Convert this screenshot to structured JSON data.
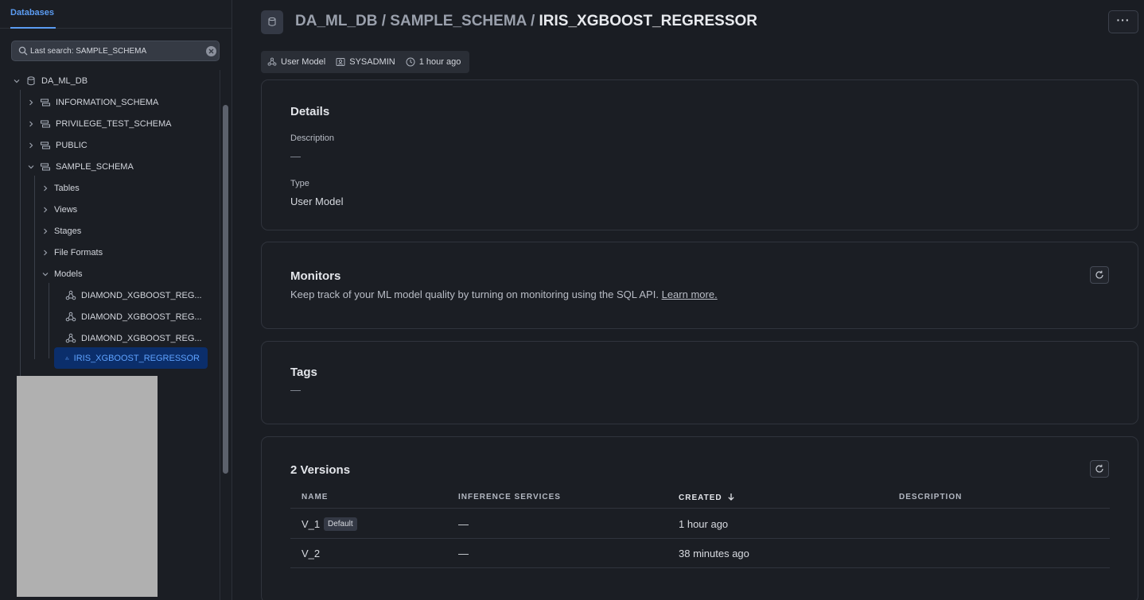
{
  "sidebar": {
    "tab_label": "Databases",
    "search": {
      "value": "",
      "placeholder": "Last search: SAMPLE_SCHEMA"
    },
    "tree": {
      "database": "DA_ML_DB",
      "schemas": [
        "INFORMATION_SCHEMA",
        "PRIVILEGE_TEST_SCHEMA",
        "PUBLIC",
        "SAMPLE_SCHEMA"
      ],
      "object_types": [
        "Tables",
        "Views",
        "Stages",
        "File Formats",
        "Models"
      ],
      "models": [
        "DIAMOND_XGBOOST_REG...",
        "DIAMOND_XGBOOST_REG...",
        "DIAMOND_XGBOOST_REG...",
        "IRIS_XGBOOST_REGRESSOR"
      ]
    }
  },
  "header": {
    "breadcrumb_db": "DA_ML_DB",
    "breadcrumb_sep1": " / ",
    "breadcrumb_schema": "SAMPLE_SCHEMA",
    "breadcrumb_sep2": " / ",
    "breadcrumb_model": "IRIS_XGBOOST_REGRESSOR",
    "more_label": "···",
    "meta": {
      "type": "User Model",
      "owner": "SYSADMIN",
      "time": "1 hour ago"
    }
  },
  "details": {
    "title": "Details",
    "description_label": "Description",
    "description_value": "—",
    "type_label": "Type",
    "type_value": "User Model"
  },
  "monitors": {
    "title": "Monitors",
    "text": "Keep track of your ML model quality by turning on monitoring using the SQL API.",
    "link": "Learn more."
  },
  "tags": {
    "title": "Tags",
    "value": "—"
  },
  "versions": {
    "title": "2 Versions",
    "columns": [
      "NAME",
      "INFERENCE SERVICES",
      "CREATED",
      "DESCRIPTION"
    ],
    "rows": [
      {
        "name": "V_1",
        "badge": "Default",
        "inference": "—",
        "created": "1 hour ago",
        "description": ""
      },
      {
        "name": "V_2",
        "badge": "",
        "inference": "—",
        "created": "38 minutes ago",
        "description": ""
      }
    ]
  }
}
